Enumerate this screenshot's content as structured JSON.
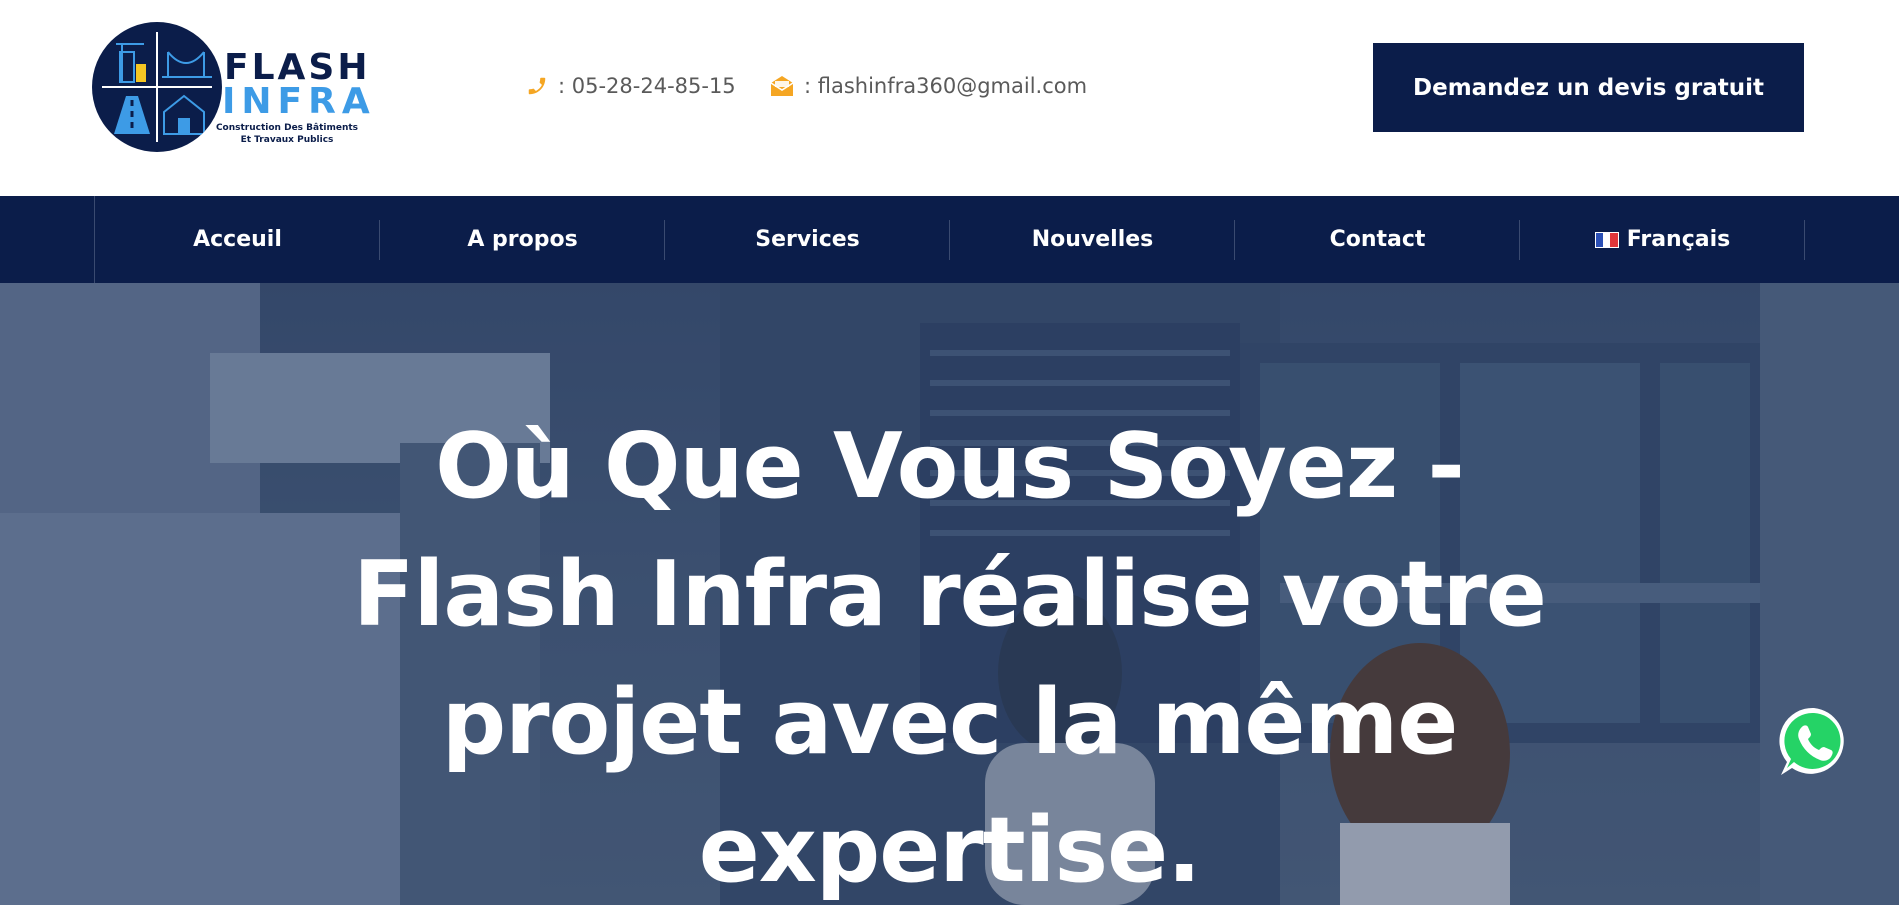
{
  "header": {
    "logo": {
      "line1": "FLASH",
      "line2": "INFRA",
      "tagline_1": "Construction Des Bâtiments",
      "tagline_2": "Et Travaux Publics"
    },
    "phone": ": 05-28-24-85-15",
    "email": ": flashinfra360@gmail.com",
    "cta_label": "Demandez un devis gratuit"
  },
  "nav": {
    "items": [
      {
        "label": "Acceuil"
      },
      {
        "label": "A propos"
      },
      {
        "label": "Services"
      },
      {
        "label": "Nouvelles"
      },
      {
        "label": "Contact"
      },
      {
        "label": "Français"
      }
    ]
  },
  "hero": {
    "title": "Où Que Vous Soyez - Flash Infra réalise votre projet avec la même expertise."
  },
  "icons": {
    "phone": "phone-icon",
    "email": "envelope-open-icon",
    "flag": "french-flag-icon",
    "whatsapp": "whatsapp-icon"
  },
  "colors": {
    "navy": "#0b1d4a",
    "accent_orange": "#f5a623",
    "logo_blue": "#3d9be6",
    "whatsapp_green": "#25d366",
    "text_gray": "#5a5a5a"
  }
}
